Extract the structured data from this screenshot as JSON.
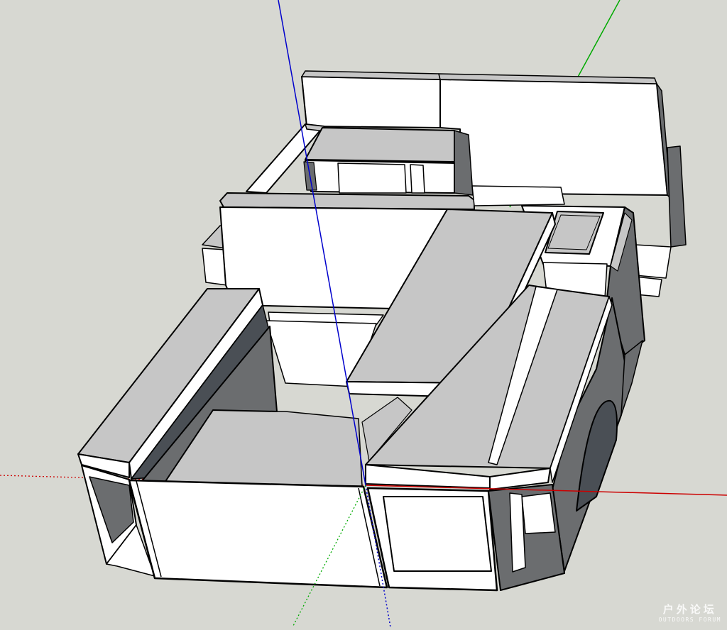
{
  "app": "SketchUp",
  "colors": {
    "background": "#d7d8d2",
    "face_light": "#ffffff",
    "face_mid": "#c6c6c6",
    "face_dark": "#6b6d6f",
    "face_darkest": "#4a4f55",
    "edge": "#000000",
    "axis_red": "#cc0000",
    "axis_green": "#00aa00",
    "axis_blue": "#0000cc"
  },
  "axes": [
    "red-axis",
    "green-axis",
    "blue-axis"
  ],
  "watermark": {
    "chinese": "户外论坛",
    "english": "OUTDOORS FORUM"
  }
}
